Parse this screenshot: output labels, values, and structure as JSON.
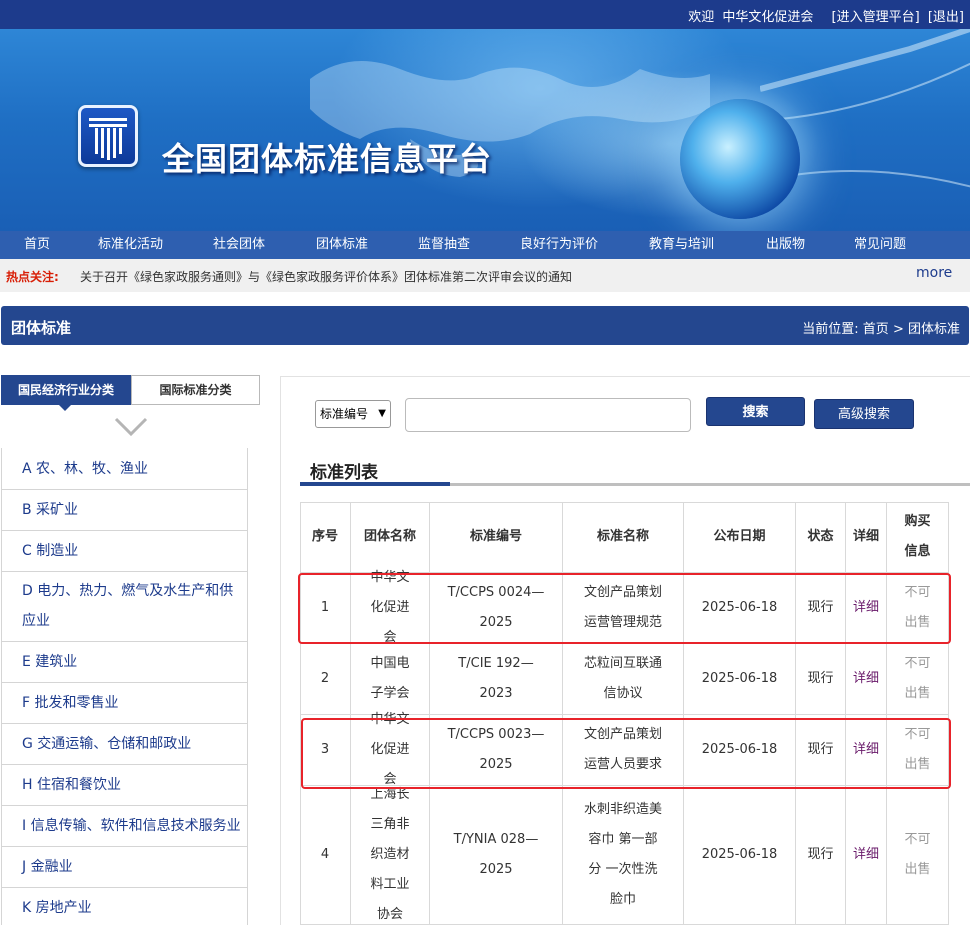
{
  "topbar": {
    "welcome": "欢迎",
    "user": "中华文化促进会",
    "admin_link": "[进入管理平台]",
    "logout_link": "[退出]"
  },
  "banner": {
    "title": "全国团体标准信息平台"
  },
  "nav": {
    "items": [
      "首页",
      "标准化活动",
      "社会团体",
      "团体标准",
      "监督抽查",
      "良好行为评价",
      "教育与培训",
      "出版物",
      "常见问题"
    ]
  },
  "hot": {
    "label": "热点关注:",
    "text": "关于召开《绿色家政服务通则》与《绿色家政服务评价体系》团体标准第二次评审会议的通知",
    "more": "more"
  },
  "section": {
    "title": "团体标准",
    "crumb_label": "当前位置:",
    "crumb_home": "首页",
    "crumb_sep": ">",
    "crumb_current": "团体标准"
  },
  "category_tabs": {
    "national": "国民经济行业分类",
    "international": "国际标准分类"
  },
  "categories": [
    "A 农、林、牧、渔业",
    "B 采矿业",
    "C 制造业",
    "D 电力、热力、燃气及水生产和供应业",
    "E 建筑业",
    "F 批发和零售业",
    "G 交通运输、仓储和邮政业",
    "H 住宿和餐饮业",
    "I 信息传输、软件和信息技术服务业",
    "J 金融业",
    "K 房地产业"
  ],
  "search": {
    "field_select": "标准编号",
    "query": "",
    "search_button": "搜索",
    "advanced_button": "高级搜索"
  },
  "list": {
    "title": "标准列表",
    "headers": [
      "序号",
      "团体名称",
      "标准编号",
      "标准名称",
      "公布日期",
      "状态",
      "详细",
      "购买信息"
    ],
    "rows": [
      {
        "no": "1",
        "org": "中华文化促进会",
        "code": "T/CCPS 0024—2025",
        "name": "文创产品策划运营管理规范",
        "date": "2025-06-18",
        "status": "现行",
        "detail": "详细",
        "buy": "不可出售"
      },
      {
        "no": "2",
        "org": "中国电子学会",
        "code": "T/CIE 192—2023",
        "name": "芯粒间互联通信协议",
        "date": "2025-06-18",
        "status": "现行",
        "detail": "详细",
        "buy": "不可出售"
      },
      {
        "no": "3",
        "org": "中华文化促进会",
        "code": "T/CCPS 0023—2025",
        "name": "文创产品策划运营人员要求",
        "date": "2025-06-18",
        "status": "现行",
        "detail": "详细",
        "buy": "不可出售"
      },
      {
        "no": "4",
        "org": "上海长三角非织造材料工业协会",
        "code": "T/YNIA 028—2025",
        "name": "水刺非织造美容巾 第一部分 一次性洗脸巾",
        "date": "2025-06-18",
        "status": "现行",
        "detail": "详细",
        "buy": "不可出售"
      }
    ]
  },
  "colors": {
    "brand": "#24478f",
    "nav": "#2e5fb0",
    "hot_label": "#d81e06",
    "highlight": "#e8232a"
  }
}
